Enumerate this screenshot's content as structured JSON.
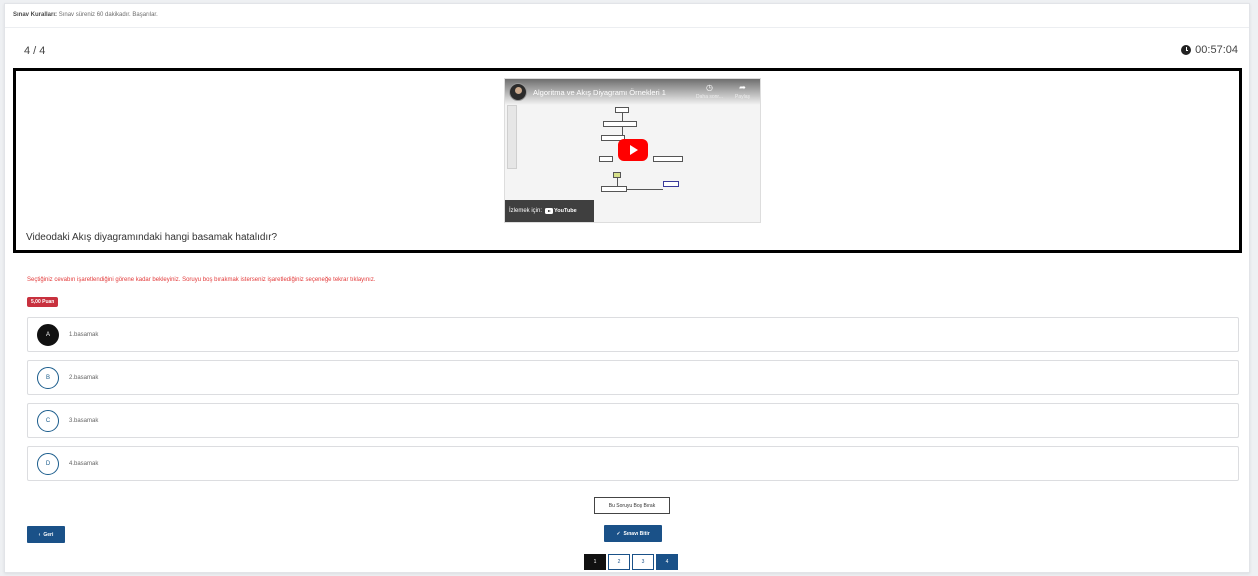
{
  "rules": {
    "label": "Sınav Kuralları:",
    "text": "Sınav süreniz 60 dakikadır. Başarılar."
  },
  "header": {
    "question_counter": "4 / 4",
    "timer": "00:57:04"
  },
  "video": {
    "title": "Algoritma ve Akış Diyagramı Örnekleri 1",
    "watch_later": "Daha sonr...",
    "share": "Paylaş",
    "watch_on": "İzlemek için:",
    "youtube": "YouTube"
  },
  "question": {
    "text": "Videodaki Akış diyagramındaki hangi basamak hatalıdır?"
  },
  "warning": "Seçtiğiniz cevabın işaretlendiğini görene kadar bekleyiniz. Soruyu boş bırakmak isterseniz işaretlediğiniz seçeneğe tekrar tıklayınız.",
  "points": "5,00 Puan",
  "options": [
    {
      "letter": "A",
      "text": "1.basamak",
      "selected": true
    },
    {
      "letter": "B",
      "text": "2.basamak",
      "selected": false
    },
    {
      "letter": "C",
      "text": "3.basamak",
      "selected": false
    },
    {
      "letter": "D",
      "text": "4.basamak",
      "selected": false
    }
  ],
  "buttons": {
    "skip": "Bu Soruyu Boş Bırak",
    "back": "Geri",
    "finish": "Sınavı Bitir"
  },
  "pager": [
    "1",
    "2",
    "3",
    "4"
  ],
  "colors": {
    "primary": "#1a5188",
    "badge": "#c8313e",
    "warning": "#e33b3b",
    "selected": "#111111"
  }
}
